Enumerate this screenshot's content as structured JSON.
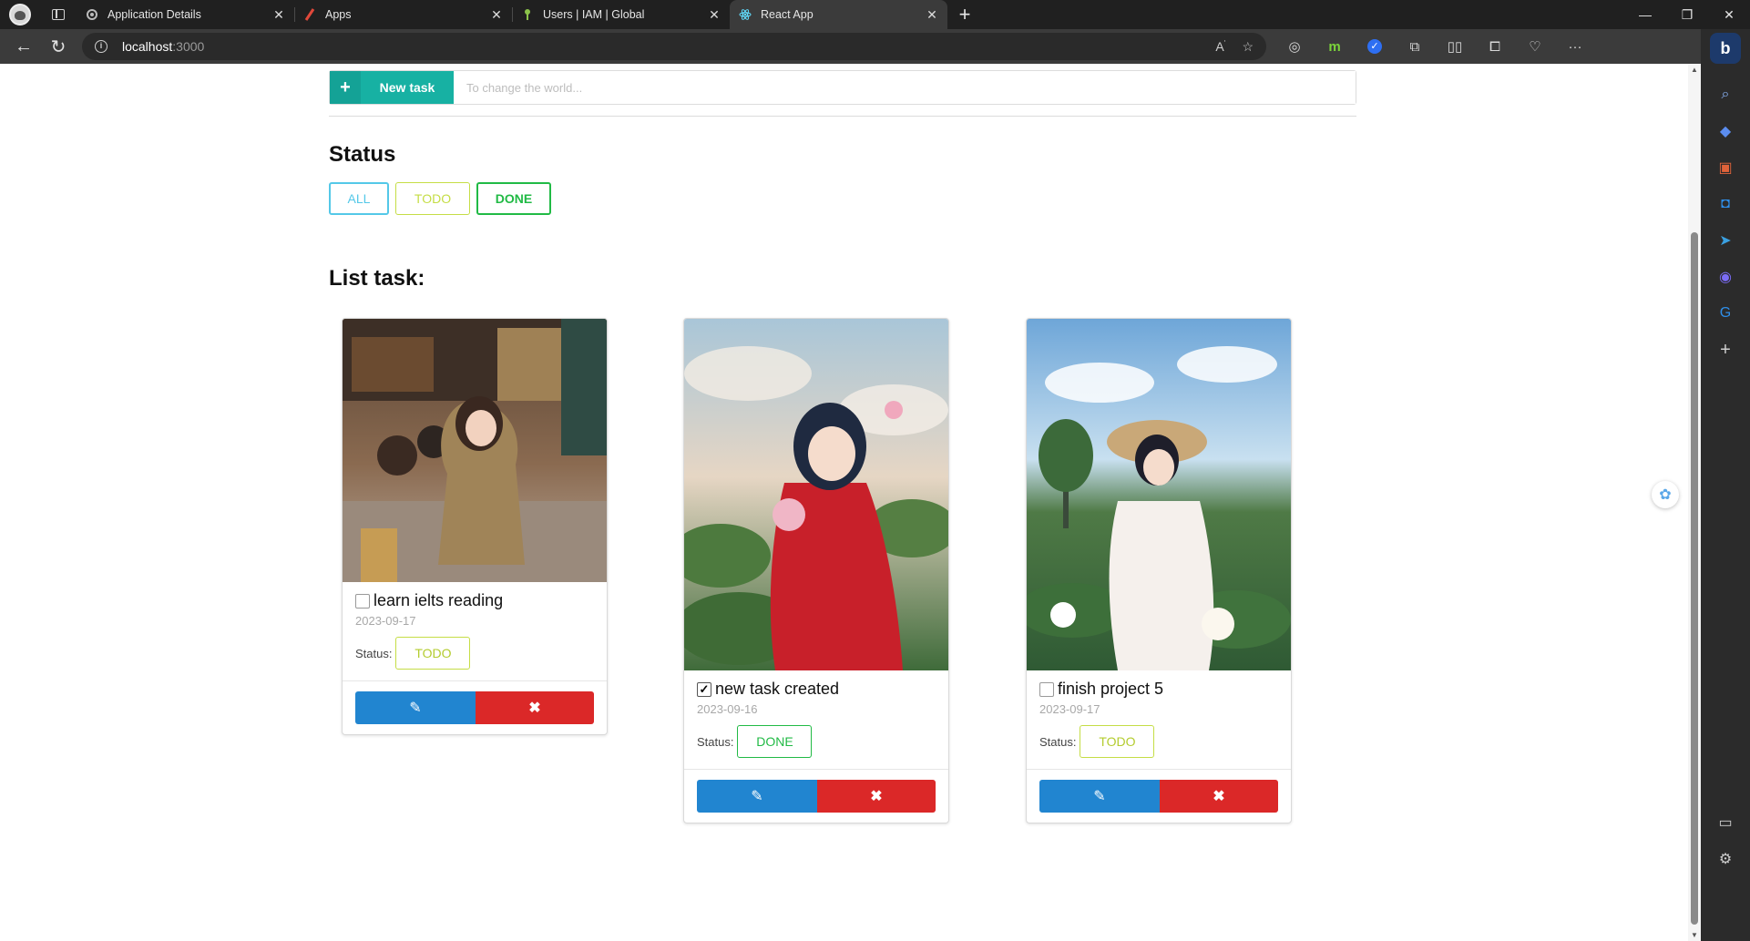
{
  "browser": {
    "tabs": [
      {
        "title": "Application Details",
        "favicon": "gear-icon"
      },
      {
        "title": "Apps",
        "favicon": "slash-icon"
      },
      {
        "title": "Users | IAM | Global",
        "favicon": "key-icon"
      },
      {
        "title": "React App",
        "favicon": "react-icon",
        "active": true
      }
    ],
    "url_host": "localhost",
    "url_port": ":3000"
  },
  "new_task": {
    "button_label": "New task",
    "placeholder": "To change the world..."
  },
  "status_section": {
    "heading": "Status",
    "filters": [
      "ALL",
      "TODO",
      "DONE"
    ]
  },
  "list_section": {
    "heading": "List task:"
  },
  "tasks": [
    {
      "title": "learn ielts reading",
      "date": "2023-09-17",
      "status_label": "Status:",
      "status": "TODO",
      "checked": false,
      "image": "girl in cafe"
    },
    {
      "title": "new task created",
      "date": "2023-09-16",
      "status_label": "Status:",
      "status": "DONE",
      "checked": true,
      "image": "girl with lotus in red dress"
    },
    {
      "title": "finish project 5",
      "date": "2023-09-17",
      "status_label": "Status:",
      "status": "TODO",
      "checked": false,
      "image": "girl in white ao dai with hat"
    }
  ],
  "colors": {
    "teal": "#17b1a3",
    "blue": "#2185d0",
    "red": "#db2828",
    "green": "#21ba45",
    "olive": "#c5dd45",
    "cyan": "#54c8e8"
  }
}
